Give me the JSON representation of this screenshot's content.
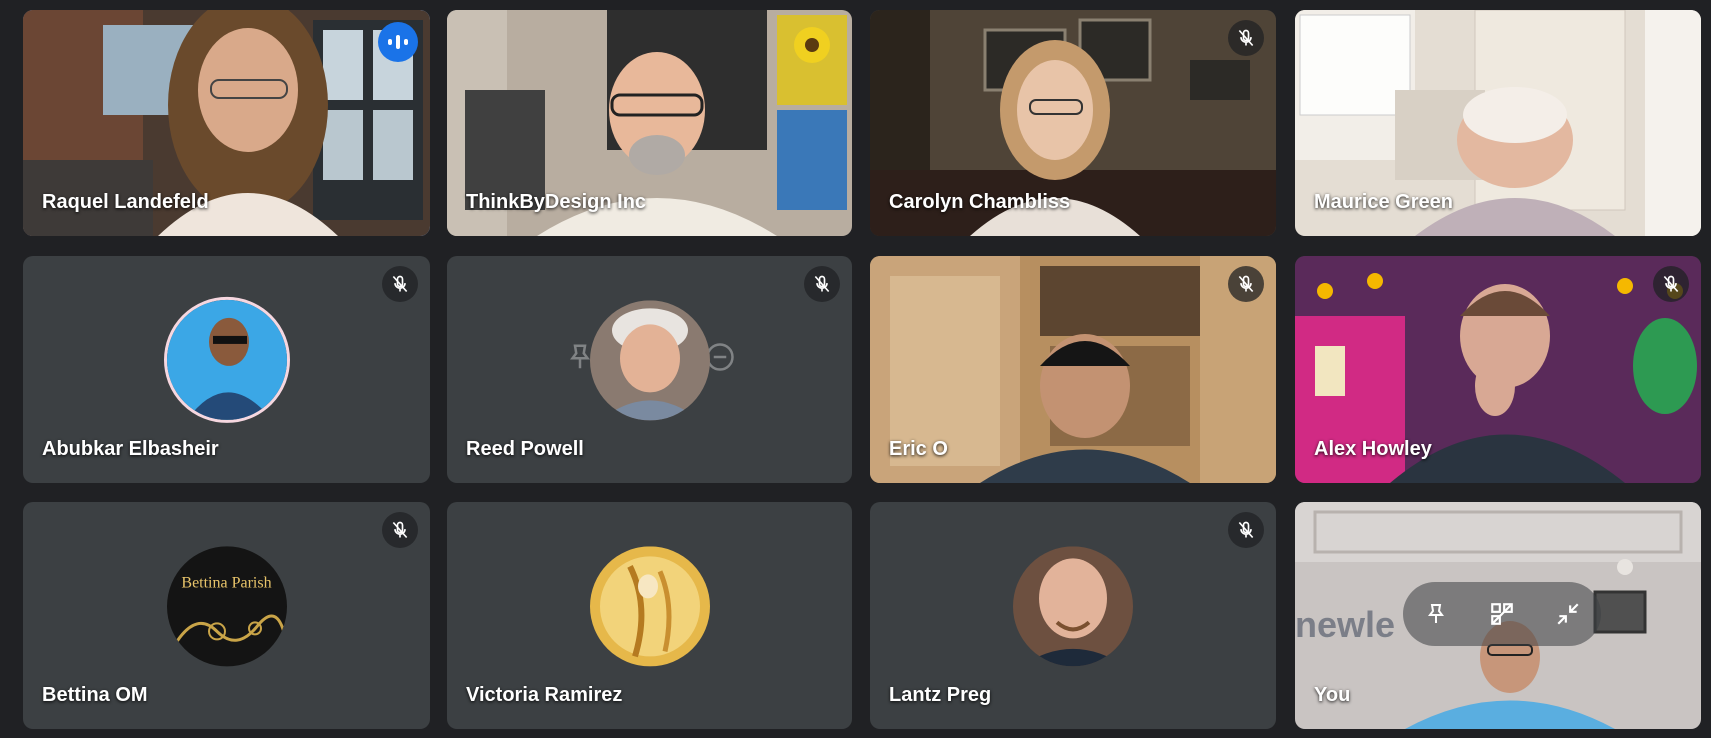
{
  "participants": [
    {
      "name": "Raquel Landefeld",
      "status": "speaking",
      "view": "video"
    },
    {
      "name": "ThinkByDesign Inc",
      "status": "unmuted",
      "view": "video"
    },
    {
      "name": "Carolyn Chambliss",
      "status": "muted",
      "view": "video"
    },
    {
      "name": "Maurice Green",
      "status": "unmuted",
      "view": "video"
    },
    {
      "name": "Abubkar Elbasheir",
      "status": "muted",
      "view": "avatar"
    },
    {
      "name": "Reed Powell",
      "status": "muted",
      "view": "avatar"
    },
    {
      "name": "Eric O",
      "status": "muted",
      "view": "video"
    },
    {
      "name": "Alex Howley",
      "status": "muted",
      "view": "video"
    },
    {
      "name": "Bettina OM",
      "status": "muted",
      "view": "avatar",
      "avatar_text": "Bettina Parish"
    },
    {
      "name": "Victoria Ramirez",
      "status": "unmuted",
      "view": "avatar"
    },
    {
      "name": "Lantz Preg",
      "status": "muted",
      "view": "avatar"
    },
    {
      "name": "You",
      "status": "unmuted",
      "view": "video",
      "backdrop_text": "newle"
    }
  ],
  "colors": {
    "background": "#202124",
    "tile": "#3c4043",
    "active_outline": "#8ab4f8",
    "speaking_badge": "#1a73e8"
  },
  "icons": {
    "mic_off": "mic-off-icon",
    "speaking": "audio-level-icon",
    "pin": "pin-icon",
    "frame": "frame-icon",
    "minimize": "minimize-icon"
  }
}
